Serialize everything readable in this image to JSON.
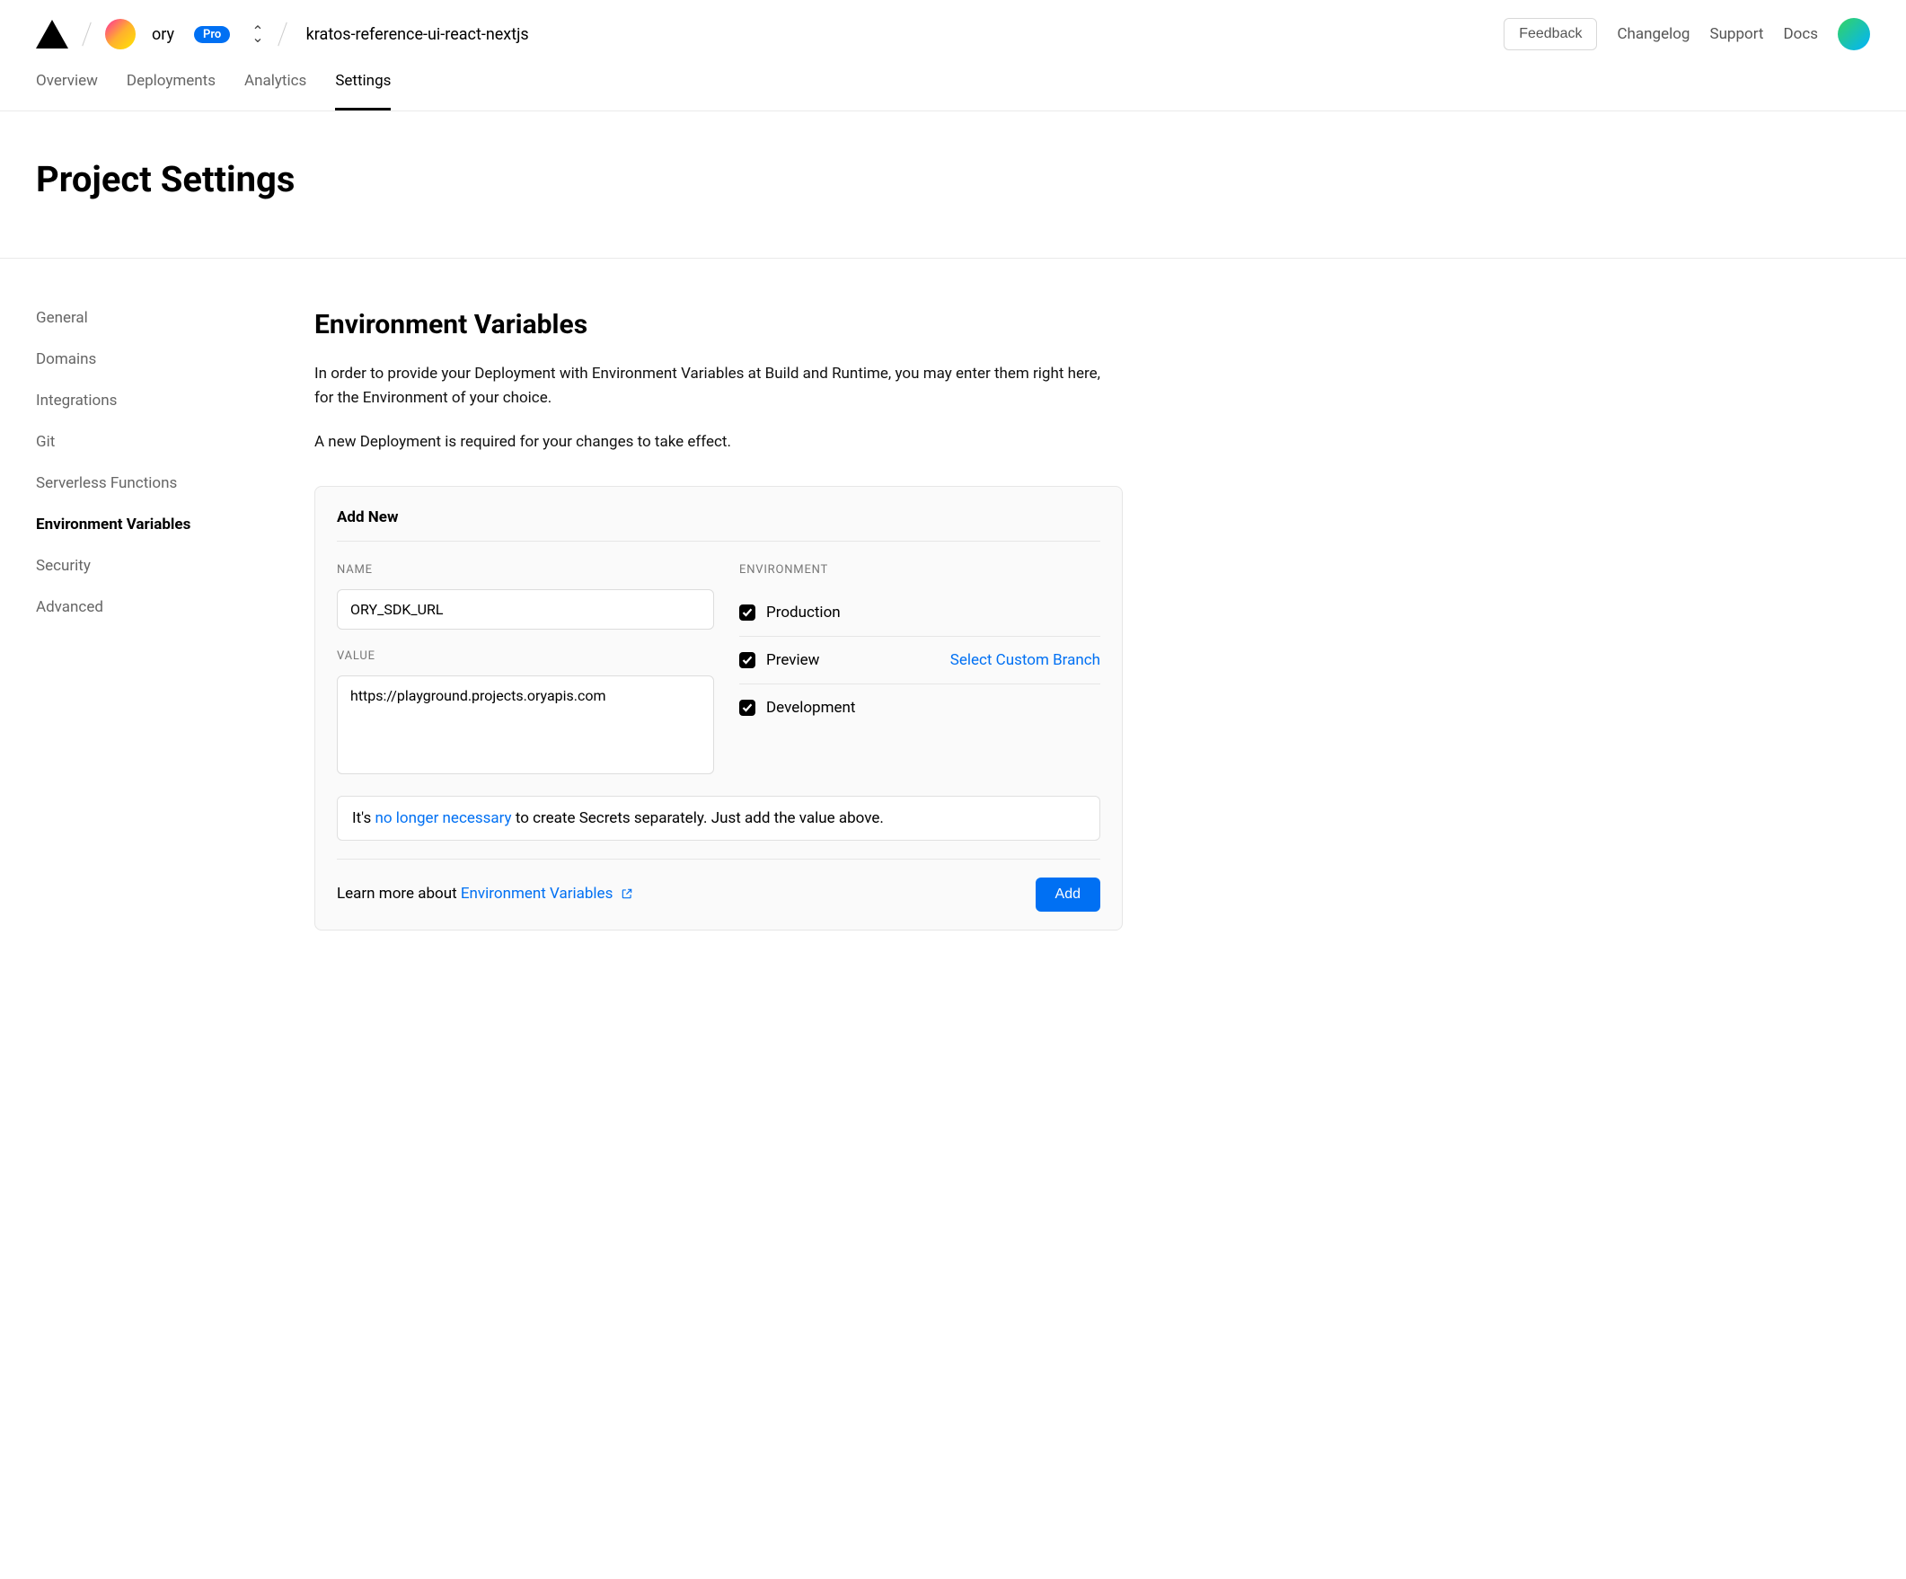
{
  "header": {
    "org": "ory",
    "badge": "Pro",
    "project": "kratos-reference-ui-react-nextjs",
    "feedback": "Feedback",
    "links": [
      "Changelog",
      "Support",
      "Docs"
    ]
  },
  "tabs": [
    "Overview",
    "Deployments",
    "Analytics",
    "Settings"
  ],
  "active_tab": 3,
  "page_title": "Project Settings",
  "sidebar": {
    "items": [
      "General",
      "Domains",
      "Integrations",
      "Git",
      "Serverless Functions",
      "Environment Variables",
      "Security",
      "Advanced"
    ],
    "active": 5
  },
  "content": {
    "heading": "Environment Variables",
    "p1": "In order to provide your Deployment with Environment Variables at Build and Runtime, you may enter them right here, for the Environment of your choice.",
    "p2": "A new Deployment is required for your changes to take effect."
  },
  "card": {
    "title": "Add New",
    "name_label": "NAME",
    "name_value": "ORY_SDK_URL",
    "value_label": "VALUE",
    "value_value": "https://playground.projects.oryapis.com",
    "env_label": "ENVIRONMENT",
    "envs": [
      {
        "label": "Production",
        "checked": true
      },
      {
        "label": "Preview",
        "checked": true,
        "extra": "Select Custom Branch"
      },
      {
        "label": "Development",
        "checked": true
      }
    ],
    "hint_pre": "It's ",
    "hint_link": "no longer necessary",
    "hint_post": " to create Secrets separately. Just add the value above.",
    "learn_pre": "Learn more about ",
    "learn_link": "Environment Variables",
    "add": "Add"
  }
}
